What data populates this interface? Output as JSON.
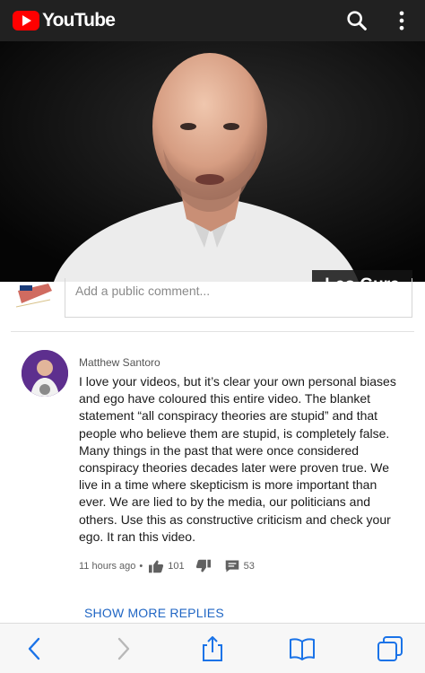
{
  "app": {
    "brand": "YouTube",
    "colors": {
      "brand_red": "#ff0000",
      "topbar_bg": "#212121",
      "link_blue": "#2066c4",
      "ios_blue": "#1a73e8"
    }
  },
  "topbar": {
    "icons": [
      "youtube-play-icon",
      "search-icon",
      "more-vert-icon"
    ]
  },
  "video": {
    "overlay_name": "Leo Gura"
  },
  "comment_input": {
    "placeholder": "Add a public comment..."
  },
  "comment": {
    "author": "Matthew Santoro",
    "text": "I love your videos, but it’s clear your own personal biases and ego have coloured this entire video. The blanket statement “all conspiracy theories are stupid” and that people who believe them are stupid, is completely false. Many things in the past that were once considered conspiracy theories decades later were proven true. We live in a time where skepticism is more important than ever. We are lied to by the media, our politicians and others. Use this as constructive criticism and check your ego. It ran this video.",
    "time": "11 hours ago",
    "dot": "•",
    "likes": "101",
    "replies": "53"
  },
  "show_more": {
    "label": "SHOW MORE REPLIES"
  },
  "browser_toolbar": {
    "icons": [
      "back-icon",
      "forward-icon",
      "share-icon",
      "bookmarks-icon",
      "tabs-icon"
    ]
  }
}
